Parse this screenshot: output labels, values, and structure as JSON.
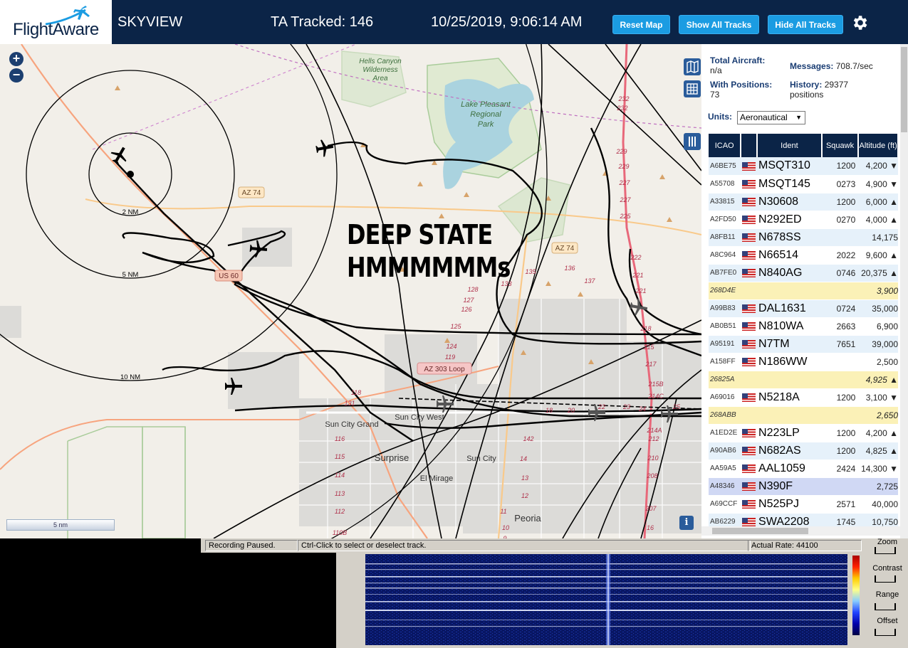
{
  "header": {
    "brand": "FlightAware",
    "app_name": "SKYVIEW",
    "tracked": "TA Tracked: 146",
    "datetime": "10/25/2019, 9:06:14 AM",
    "reset_map": "Reset Map",
    "show_tracks": "Show All Tracks",
    "hide_tracks": "Hide All Tracks"
  },
  "map": {
    "zoom_in": "+",
    "zoom_out": "−",
    "overlay_text_1": "DEEP STATE",
    "overlay_text_2": "HMMMMMMs",
    "scale_label": "5 nm",
    "info": "i",
    "labels": {
      "wilderness": [
        "Hells Canyon",
        "Wilderness",
        "Area"
      ],
      "park": [
        "Lake Pleasant",
        "Regional",
        "Park"
      ],
      "ring_2": "2 NM",
      "ring_5": "5 NM",
      "ring_10": "10 NM",
      "az74_a": "AZ 74",
      "az74_b": "AZ 74",
      "us60": "US 60",
      "az303": "AZ 303 Loop",
      "sun_city_grand": "Sun City Grand",
      "sun_city_west": "Sun City West",
      "surprise": "Surprise",
      "sun_city": "Sun City",
      "el_mirage": "El Mirage",
      "peoria": "Peoria"
    },
    "exits_left": [
      "116",
      "115",
      "114",
      "113",
      "112",
      "110B"
    ],
    "exits_mid": [
      "142",
      "14",
      "13",
      "12",
      "11",
      "10",
      "9",
      "128",
      "127",
      "126",
      "125",
      "124",
      "119",
      "118",
      "131",
      "133",
      "135",
      "136",
      "137"
    ],
    "exits_right": [
      "232",
      "232",
      "229",
      "229",
      "227",
      "227",
      "225",
      "222",
      "221",
      "221",
      "218",
      "215",
      "217",
      "215B",
      "214C",
      "214A",
      "212",
      "210",
      "208",
      "207",
      "16",
      "18",
      "20",
      "22",
      "23",
      "24",
      "25"
    ]
  },
  "panel": {
    "total_aircraft_label": "Total Aircraft:",
    "total_aircraft_value": "n/a",
    "messages_label": "Messages:",
    "messages_value": "708.7/sec",
    "with_positions_label": "With Positions:",
    "with_positions_value": "73",
    "history_label": "History:",
    "history_value": "29377",
    "history_unit": "positions",
    "units_label": "Units:",
    "units_value": "Aeronautical",
    "columns": [
      "ICAO",
      "",
      "Ident",
      "Squawk",
      "Altitude (ft)"
    ]
  },
  "aircraft": [
    {
      "icao": "A6BE75",
      "ident": "MSQT310",
      "squawk": "1200",
      "alt": "4,200 ▼",
      "flag": true,
      "style": "r"
    },
    {
      "icao": "A55708",
      "ident": "MSQT145",
      "squawk": "0273",
      "alt": "4,900 ▼",
      "flag": true,
      "style": "w"
    },
    {
      "icao": "A33815",
      "ident": "N30608",
      "squawk": "1200",
      "alt": "6,000 ▲",
      "flag": true,
      "style": "r"
    },
    {
      "icao": "A2FD50",
      "ident": "N292ED",
      "squawk": "0270",
      "alt": "4,000 ▲",
      "flag": true,
      "style": "w"
    },
    {
      "icao": "A8FB11",
      "ident": "N678SS",
      "squawk": "",
      "alt": "14,175",
      "flag": true,
      "style": "r"
    },
    {
      "icao": "A8C964",
      "ident": "N66514",
      "squawk": "2022",
      "alt": "9,600 ▲",
      "flag": true,
      "style": "w"
    },
    {
      "icao": "AB7FE0",
      "ident": "N840AG",
      "squawk": "0746",
      "alt": "20,375 ▲",
      "flag": true,
      "style": "r"
    },
    {
      "icao": "268D4E",
      "ident": "",
      "squawk": "",
      "alt": "3,900",
      "flag": false,
      "style": "y"
    },
    {
      "icao": "A99B83",
      "ident": "DAL1631",
      "squawk": "0724",
      "alt": "35,000",
      "flag": true,
      "style": "r"
    },
    {
      "icao": "AB0B51",
      "ident": "N810WA",
      "squawk": "2663",
      "alt": "6,900",
      "flag": true,
      "style": "w"
    },
    {
      "icao": "A95191",
      "ident": "N7TM",
      "squawk": "7651",
      "alt": "39,000",
      "flag": true,
      "style": "r"
    },
    {
      "icao": "A158FF",
      "ident": "N186WW",
      "squawk": "",
      "alt": "2,500",
      "flag": true,
      "style": "w"
    },
    {
      "icao": "26825A",
      "ident": "",
      "squawk": "",
      "alt": "4,925 ▲",
      "flag": false,
      "style": "y"
    },
    {
      "icao": "A69016",
      "ident": "N5218A",
      "squawk": "1200",
      "alt": "3,100 ▼",
      "flag": true,
      "style": "w"
    },
    {
      "icao": "268ABB",
      "ident": "",
      "squawk": "",
      "alt": "2,650",
      "flag": false,
      "style": "y"
    },
    {
      "icao": "A1ED2E",
      "ident": "N223LP",
      "squawk": "1200",
      "alt": "4,200 ▲",
      "flag": true,
      "style": "w"
    },
    {
      "icao": "A90AB6",
      "ident": "N682AS",
      "squawk": "1200",
      "alt": "4,825 ▲",
      "flag": true,
      "style": "r"
    },
    {
      "icao": "AA59A5",
      "ident": "AAL1059",
      "squawk": "2424",
      "alt": "14,300 ▼",
      "flag": true,
      "style": "w"
    },
    {
      "icao": "A48346",
      "ident": "N390F",
      "squawk": "",
      "alt": "2,725",
      "flag": true,
      "style": "s"
    },
    {
      "icao": "A69CCF",
      "ident": "N525PJ",
      "squawk": "2571",
      "alt": "40,000",
      "flag": true,
      "style": "w"
    },
    {
      "icao": "AB6229",
      "ident": "SWA2208",
      "squawk": "1745",
      "alt": "10,750",
      "flag": true,
      "style": "r"
    }
  ],
  "statusbar": {
    "recording": "Recording Paused.",
    "hint": "Ctrl-Click to select or deselect track.",
    "rate": "Actual Rate: 44100"
  },
  "controls": {
    "zoom": "Zoom",
    "contrast": "Contrast",
    "range": "Range",
    "offset": "Offset"
  },
  "colors": {
    "header_bg": "#0b2447",
    "button_blue": "#1b9ce2",
    "table_header": "#0b2447",
    "row_alt": "#e6f1fa",
    "row_unknown": "#fbf1b7",
    "row_selected": "#d0d8f4"
  }
}
